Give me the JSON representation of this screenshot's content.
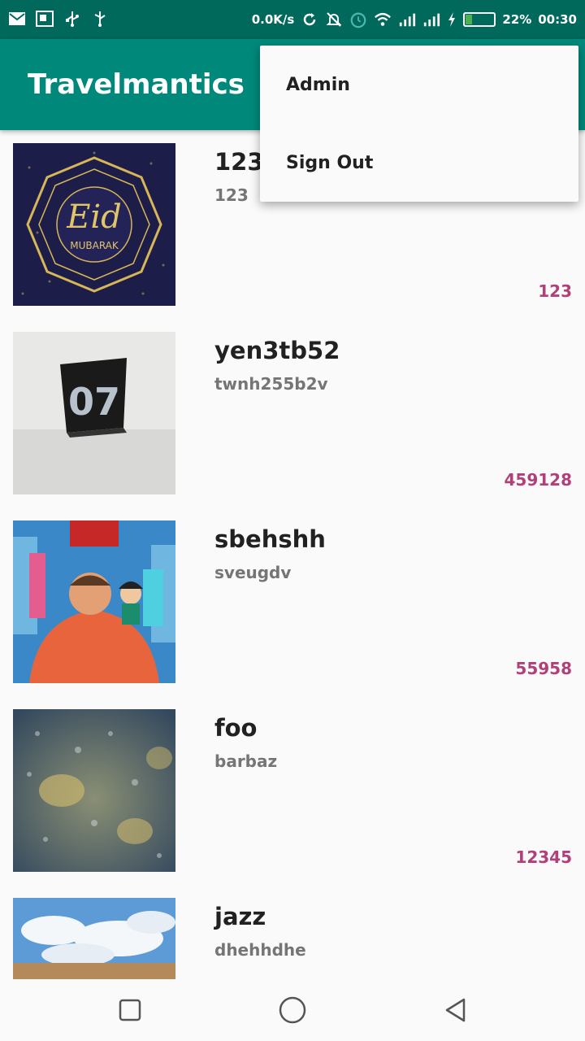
{
  "status_bar": {
    "left_icons": [
      "mail-icon",
      "screenshot-icon",
      "usb-icon",
      "usb-debug-icon"
    ],
    "network_speed": "0.0K/s",
    "right_icons": [
      "sync-icon",
      "mute-icon",
      "alarm-icon",
      "wifi-icon",
      "signal-icon",
      "signal-icon",
      "charging-icon"
    ],
    "battery_level": 0.22,
    "battery": "22%",
    "time": "00:30"
  },
  "app_bar": {
    "title": "Travelmantics"
  },
  "overflow_menu": {
    "items": [
      {
        "label": "Admin"
      },
      {
        "label": "Sign Out"
      }
    ]
  },
  "deals": [
    {
      "title": "123",
      "description": "123",
      "price": "123",
      "image": "eid-mubarak-image"
    },
    {
      "title": "yen3tb52",
      "description": "twnh255b2v",
      "price": "459128",
      "image": "number-07-card-image"
    },
    {
      "title": "sbehshh",
      "description": "sveugdv",
      "price": "55958",
      "image": "ralph-breaks-internet-poster-image"
    },
    {
      "title": "foo",
      "description": "barbaz",
      "price": "12345",
      "image": "water-droplets-image"
    },
    {
      "title": "jazz",
      "description": "dhehhdhe",
      "price": "",
      "image": "sky-clouds-image"
    }
  ],
  "nav_bar": {
    "buttons": [
      "recents-button",
      "home-button",
      "back-button"
    ]
  },
  "colors": {
    "primary": "#00897b",
    "primary_dark": "#00695c",
    "price": "#b0407a",
    "background": "#fafafa"
  }
}
